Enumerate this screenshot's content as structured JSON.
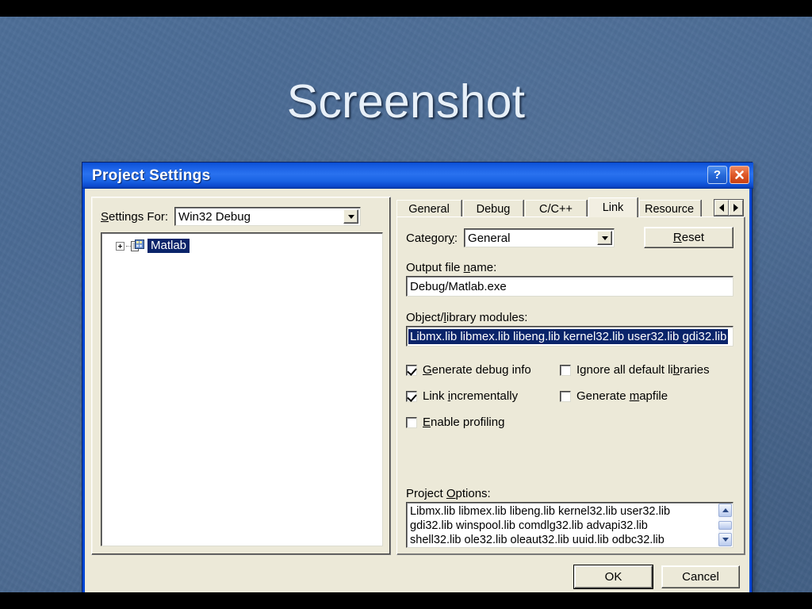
{
  "slide": {
    "title": "Screenshot",
    "background_color": "#4a6a93",
    "title_color": "#e8f0f8"
  },
  "dialog": {
    "title": "Project Settings",
    "titlebar_color": "#2a72ef",
    "face_color": "#ece9d8",
    "help_button": "?",
    "close_button": "close-icon"
  },
  "left_pane": {
    "settings_for_label": "Settings For:",
    "settings_for_value": "Win32 Debug",
    "tree": {
      "expander": "+",
      "node_label": "Matlab",
      "node_selected": true,
      "selection_color": "#0a246a"
    }
  },
  "tabs": {
    "items": [
      {
        "label": "General",
        "active": false
      },
      {
        "label": "Debug",
        "active": false
      },
      {
        "label": "C/C++",
        "active": false
      },
      {
        "label": "Link",
        "active": true
      },
      {
        "label": "Resource",
        "active": false
      }
    ],
    "scroll_left": "left-arrow-icon",
    "scroll_right": "right-arrow-icon"
  },
  "link_page": {
    "category_label": "Category:",
    "category_value": "General",
    "reset_label": "Reset",
    "output_file_label": "Output file name:",
    "output_file_value": "Debug/Matlab.exe",
    "object_modules_label": "Object/library modules:",
    "object_modules_value": "Libmx.lib libmex.lib libeng.lib kernel32.lib user32.lib gdi32.lib",
    "object_modules_selected": true,
    "checkboxes": [
      {
        "label": "Generate debug info",
        "checked": true
      },
      {
        "label": "Ignore all default libraries",
        "checked": false
      },
      {
        "label": "Link incrementally",
        "checked": true
      },
      {
        "label": "Generate mapfile",
        "checked": false
      },
      {
        "label": "Enable profiling",
        "checked": false
      }
    ],
    "project_options_label": "Project Options:",
    "project_options_value": "Libmx.lib libmex.lib libeng.lib kernel32.lib user32.lib\ngdi32.lib winspool.lib comdlg32.lib advapi32.lib\nshell32.lib ole32.lib oleaut32.lib uuid.lib odbc32.lib"
  },
  "footer": {
    "ok_label": "OK",
    "cancel_label": "Cancel",
    "default_button": "OK"
  }
}
